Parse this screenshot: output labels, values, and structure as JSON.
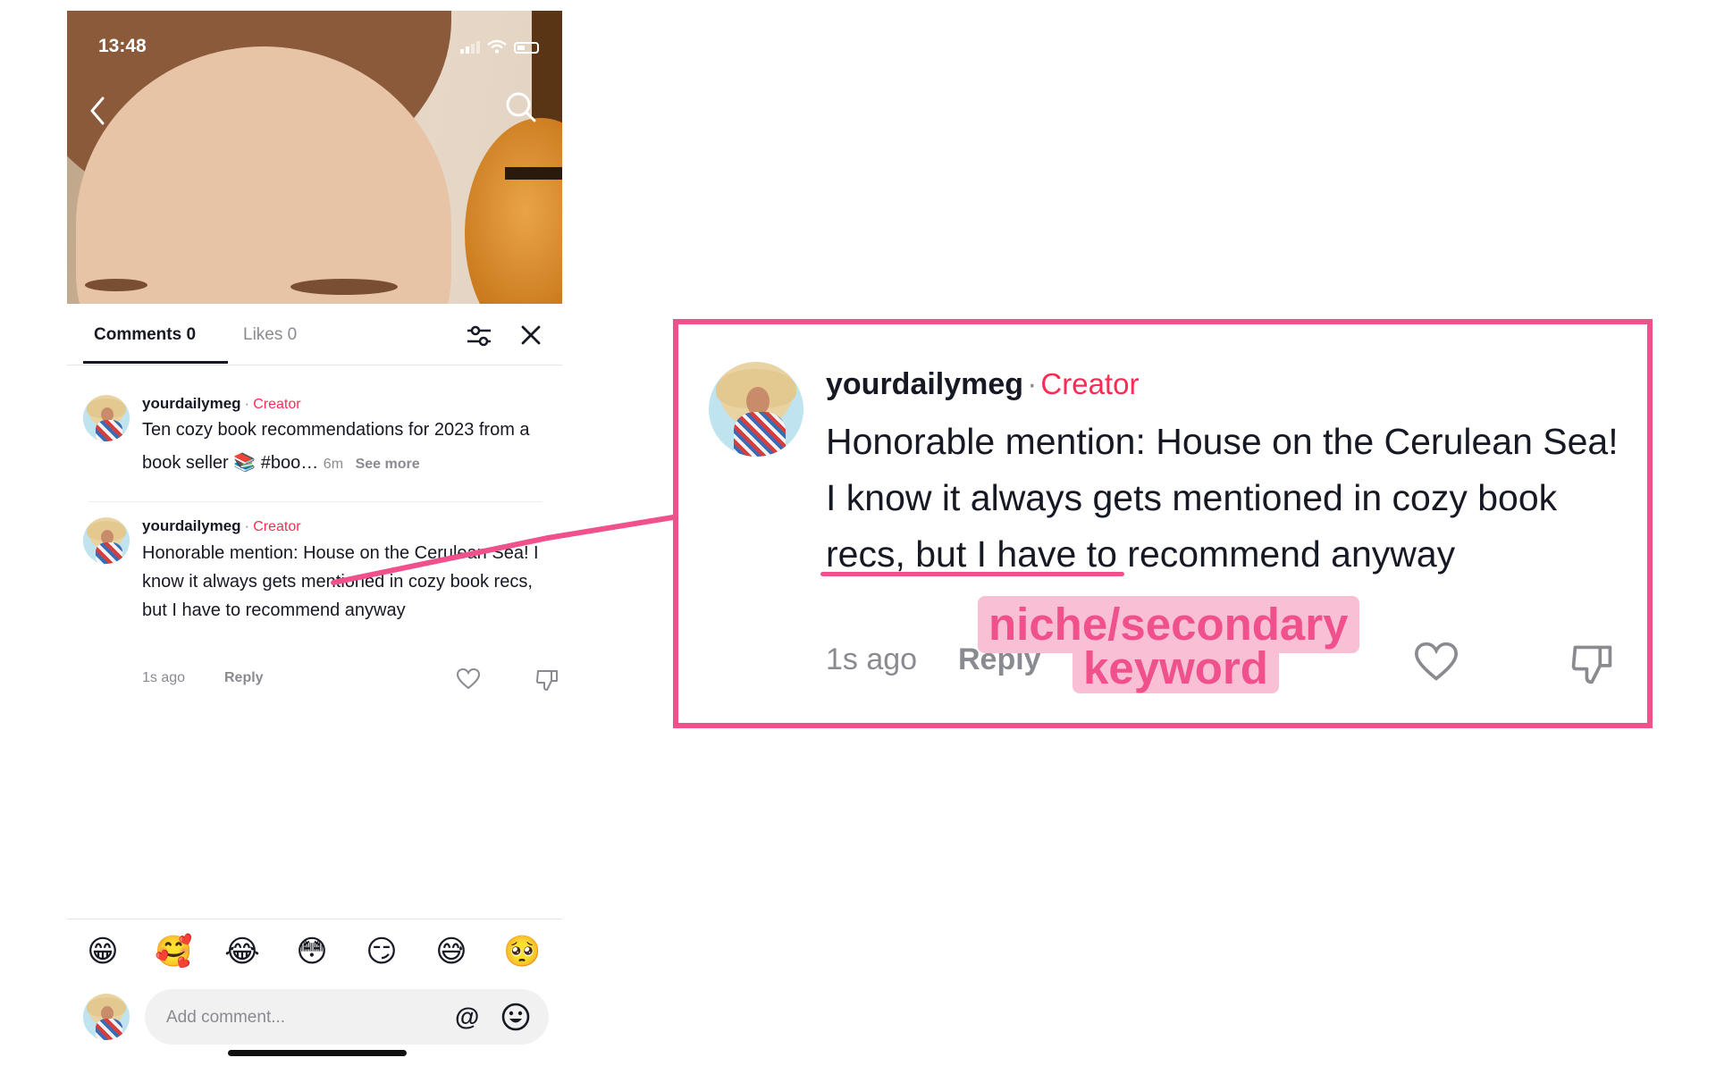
{
  "status_bar": {
    "time": "13:48"
  },
  "tabs": {
    "comments": "Comments 0",
    "likes": "Likes 0"
  },
  "comments": [
    {
      "username": "yourdailymeg",
      "badge": "Creator",
      "text": "Ten cozy book recommendations for 2023 from a book seller 📚 #boo…",
      "time": "6m",
      "see_more": "See more"
    },
    {
      "username": "yourdailymeg",
      "badge": "Creator",
      "text": "Honorable mention: House on the Cerulean Sea! I know it always gets mentioned in cozy book recs, but I have to recommend anyway",
      "time": "1s ago",
      "reply": "Reply"
    }
  ],
  "emoji_bar": [
    "😁",
    "🥰",
    "😂",
    "😳",
    "😏",
    "😅",
    "🥺"
  ],
  "comment_input": {
    "placeholder": "Add comment...",
    "mention": "@"
  },
  "zoom": {
    "username": "yourdailymeg",
    "badge": "Creator",
    "text_before": "Honorable mention: House on the Cerulean Sea! I know it always gets mentioned in ",
    "keyword": "cozy book recs,",
    "text_after": " but I have to recommend anyway",
    "time": "1s ago",
    "reply": "Reply"
  },
  "annotation": {
    "line1": "niche/secondary",
    "line2": "keyword"
  },
  "colors": {
    "accent": "#f0508c",
    "creator": "#fe2c55",
    "tag_bg": "#f9bfd5"
  },
  "icons": [
    "back-icon",
    "search-icon",
    "filter-icon",
    "close-icon",
    "heart-icon",
    "dislike-icon",
    "smile-icon"
  ]
}
